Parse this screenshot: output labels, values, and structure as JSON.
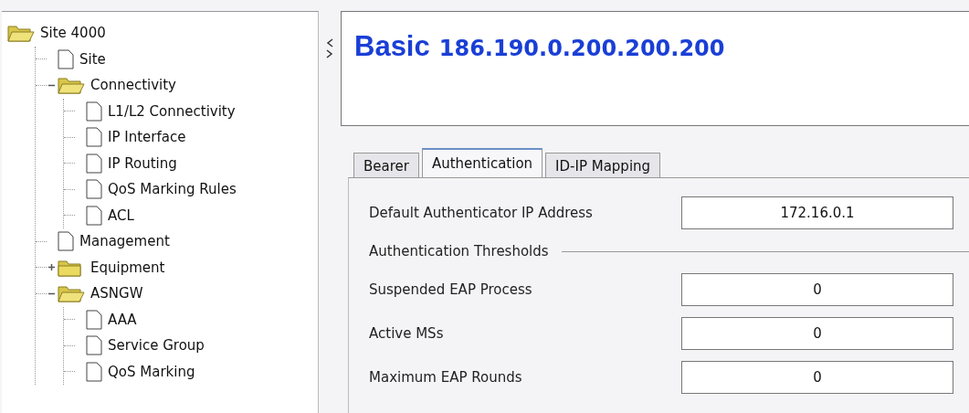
{
  "tree": [
    {
      "label": "Site 4000",
      "kind": "folder",
      "expanded": true,
      "children": [
        {
          "label": "Site",
          "kind": "page"
        },
        {
          "label": "Connectivity",
          "kind": "folder",
          "expanded": true,
          "children": [
            {
              "label": "L1/L2 Connectivity",
              "kind": "page"
            },
            {
              "label": "IP Interface",
              "kind": "page"
            },
            {
              "label": "IP Routing",
              "kind": "page"
            },
            {
              "label": "QoS Marking Rules",
              "kind": "page"
            },
            {
              "label": "ACL",
              "kind": "page"
            }
          ]
        },
        {
          "label": "Management",
          "kind": "page"
        },
        {
          "label": "Equipment",
          "kind": "folder",
          "expanded": false
        },
        {
          "label": "ASNGW",
          "kind": "folder",
          "expanded": true,
          "children": [
            {
              "label": "AAA",
              "kind": "page"
            },
            {
              "label": "Service Group",
              "kind": "page"
            },
            {
              "label": "QoS Marking",
              "kind": "page"
            }
          ]
        }
      ]
    }
  ],
  "header": {
    "title": "Basic",
    "address": "186.190.0.200.200.200"
  },
  "tabs": [
    {
      "label": "Bearer",
      "selected": false
    },
    {
      "label": "Authentication",
      "selected": true
    },
    {
      "label": "ID-IP Mapping",
      "selected": false
    }
  ],
  "form": [
    {
      "kind": "field",
      "label": "Default Authenticator IP Address",
      "value": "172.16.0.1"
    },
    {
      "kind": "section",
      "label": "Authentication Thresholds"
    },
    {
      "kind": "field",
      "label": "Suspended EAP Process",
      "value": "0"
    },
    {
      "kind": "field",
      "label": "Active MSs",
      "value": "0"
    },
    {
      "kind": "field",
      "label": "Maximum EAP Rounds",
      "value": "0"
    }
  ]
}
